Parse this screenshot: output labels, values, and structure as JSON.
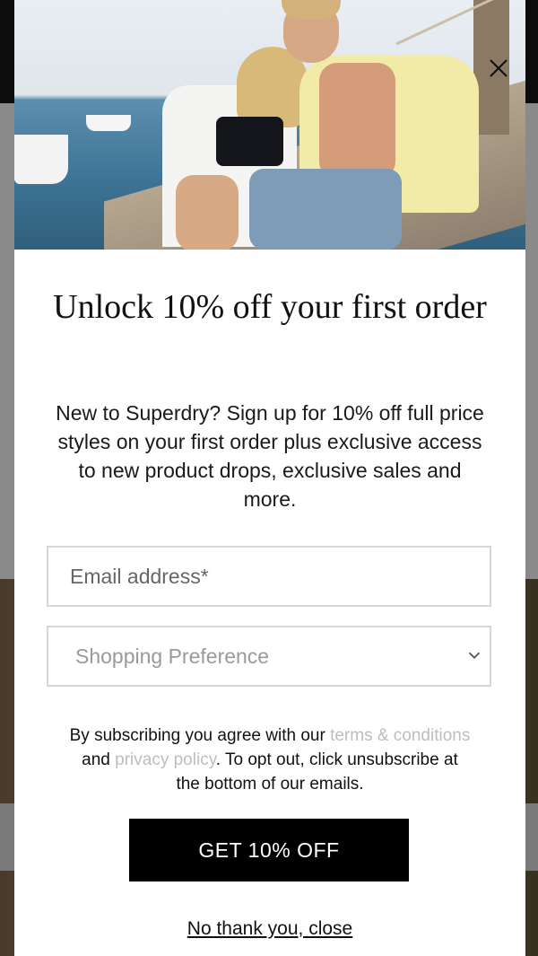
{
  "modal": {
    "close_icon": "close-icon",
    "title": "Unlock 10% off your first order",
    "description": "New to Superdry? Sign up for 10% off full price styles on your first order plus exclusive access to new product drops, exclusive sales and more.",
    "email": {
      "placeholder": "Email address*",
      "value": ""
    },
    "preference": {
      "selected": "Shopping Preference",
      "icon": "chevron-down-icon"
    },
    "legal": {
      "prefix": "By subscribing you agree with our ",
      "terms_link": "terms & conditions",
      "and": " and ",
      "privacy_link": "privacy policy",
      "suffix": ". To opt out, click unsubscribe at the bottom of our emails."
    },
    "cta_label": "GET 10% OFF",
    "dismiss_label": "No thank you, close"
  },
  "colors": {
    "cta_background": "#000000",
    "link_text": "#bdbdbd",
    "input_border": "#d7d7d7"
  }
}
